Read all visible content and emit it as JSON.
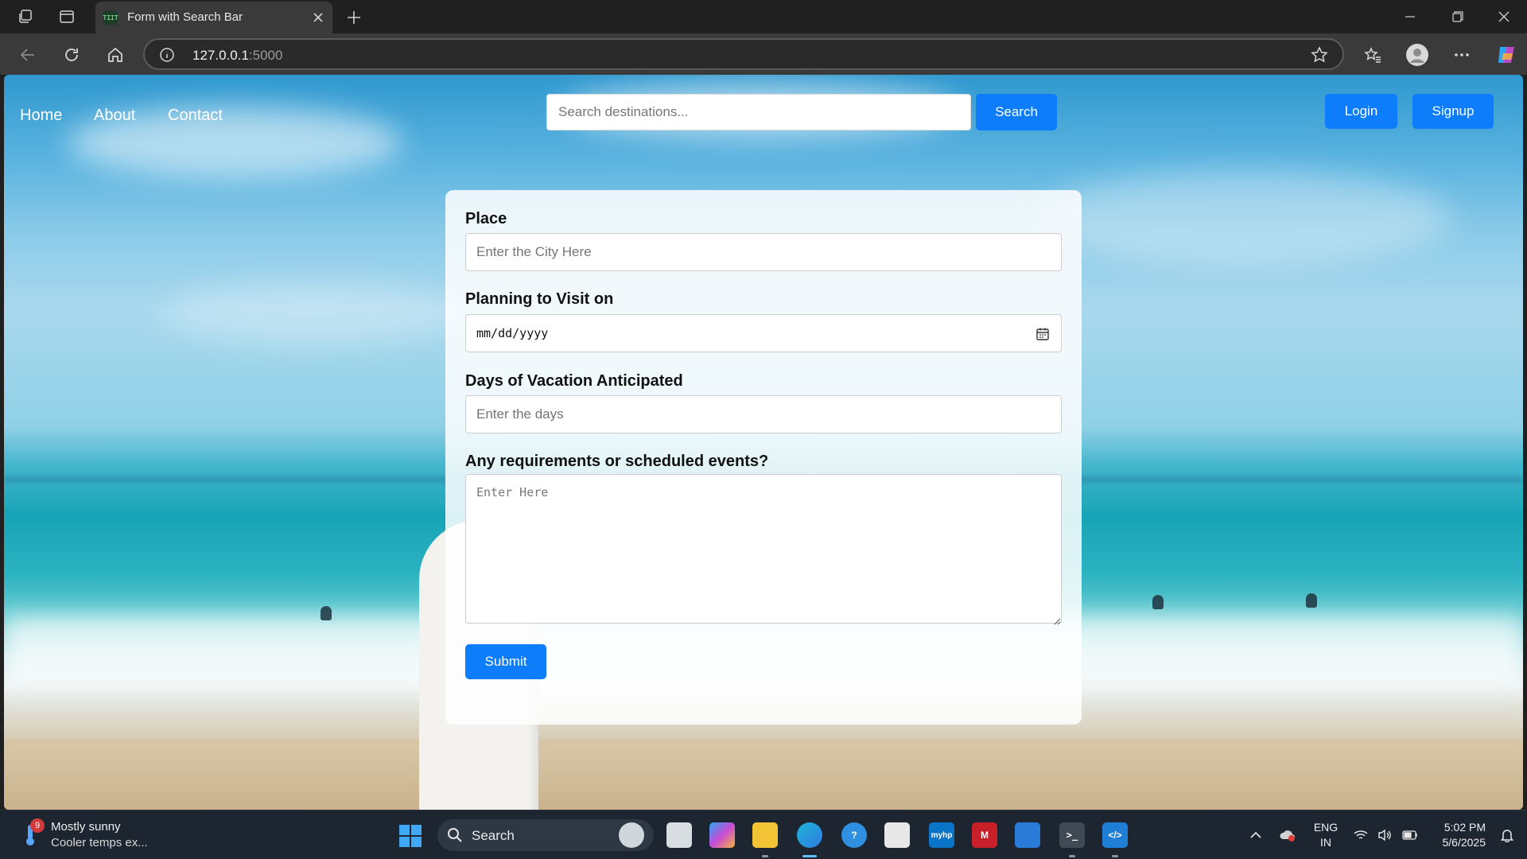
{
  "browser": {
    "tab": {
      "favicon_text": "TIIT",
      "title": "Form with Search Bar"
    },
    "address": {
      "host": "127.0.0.1",
      "port": ":5000"
    }
  },
  "site": {
    "nav": [
      "Home",
      "About",
      "Contact"
    ],
    "search": {
      "placeholder": "Search destinations...",
      "button": "Search"
    },
    "auth": {
      "login": "Login",
      "signup": "Signup"
    }
  },
  "form": {
    "place": {
      "label": "Place",
      "placeholder": "Enter the City Here"
    },
    "visit_date": {
      "label": "Planning to Visit on",
      "value": "mm/dd/yyyy"
    },
    "days": {
      "label": "Days of Vacation Anticipated",
      "placeholder": "Enter the days"
    },
    "requirements": {
      "label": "Any requirements or scheduled events?",
      "placeholder": "Enter Here"
    },
    "submit": "Submit"
  },
  "taskbar": {
    "weather": {
      "badge": "9",
      "line1": "Mostly sunny",
      "line2": "Cooler temps ex..."
    },
    "search": "Search",
    "language": {
      "line1": "ENG",
      "line2": "IN"
    },
    "time": "5:02 PM",
    "date": "5/6/2025"
  },
  "colors": {
    "accent": "#0d7dfc",
    "chrome_dark": "#202020",
    "chrome_mid": "#3a3a3a",
    "taskbar": "#1c2530"
  }
}
